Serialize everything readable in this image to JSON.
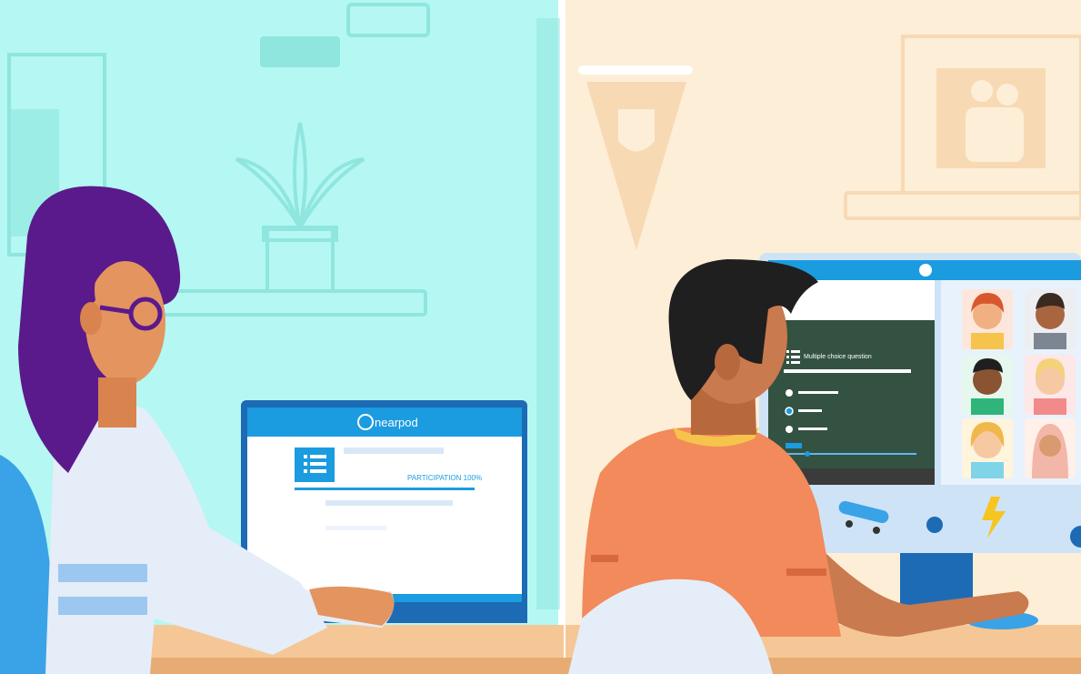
{
  "teacher_laptop": {
    "brand": "nearpod",
    "participation_label": "PARTICIPATION 100%"
  },
  "student_monitor": {
    "question_title": "Multiple choice question"
  },
  "colors": {
    "left_wall": "#b5f7f2",
    "right_wall": "#fdeed8",
    "desk": "#f6c796",
    "nearpod_blue": "#1b9be0",
    "laptop_frame": "#1d6bb5",
    "hair_purple": "#5a1a8c",
    "shirt_orange": "#f28a5b",
    "skin": "#c97a4e"
  },
  "icons": [
    "list-icon",
    "skateboard-icon",
    "lightning-icon",
    "user-icon"
  ]
}
